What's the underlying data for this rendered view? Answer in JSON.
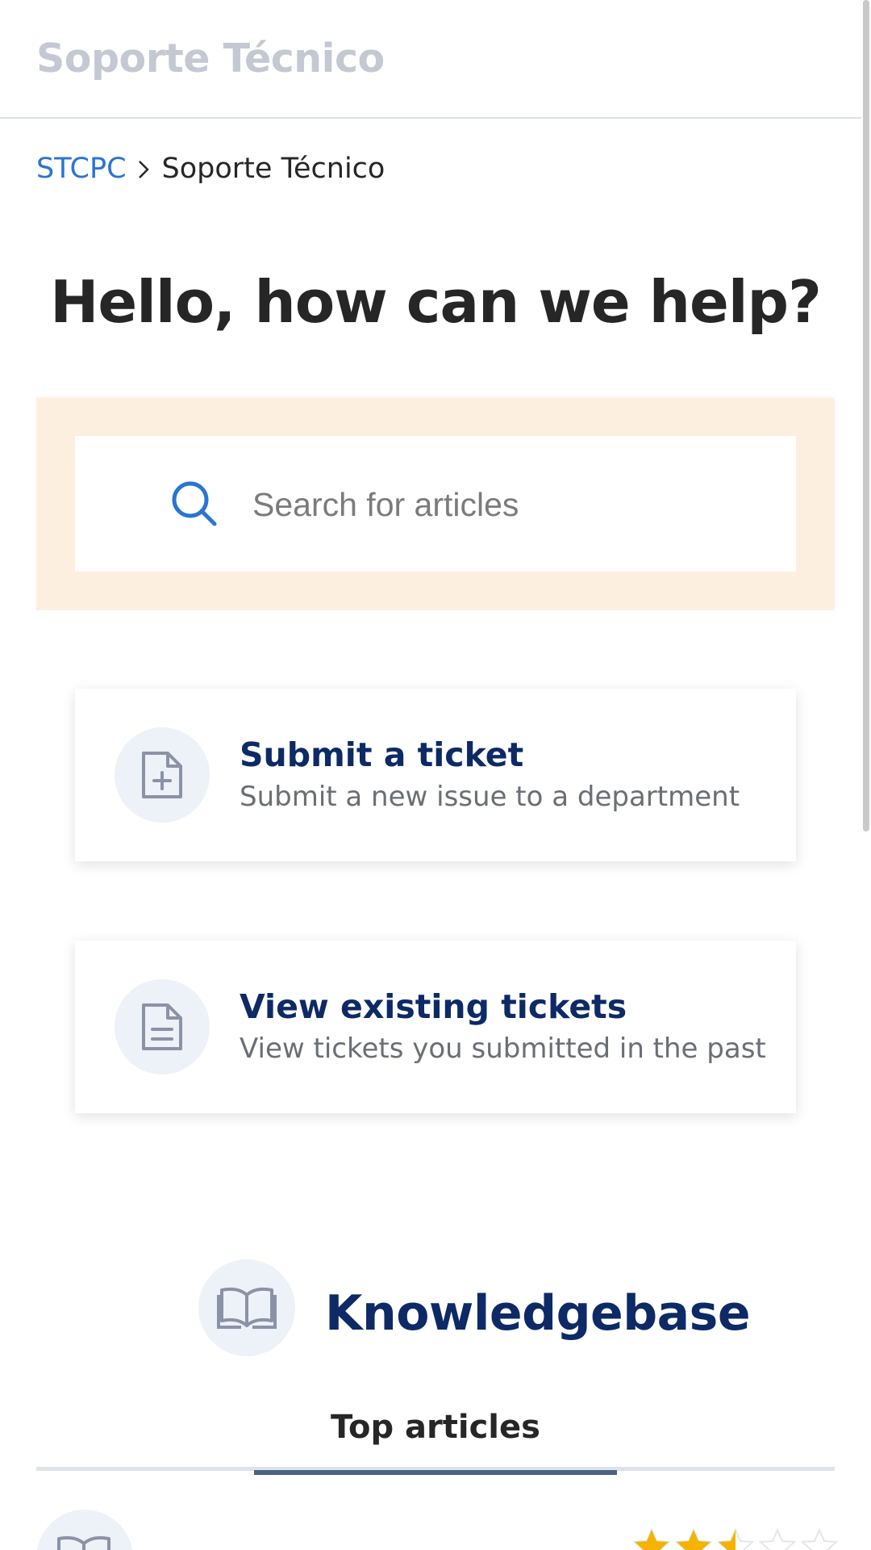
{
  "header": {
    "brand": "Soporte Técnico"
  },
  "breadcrumb": {
    "home": "STCPC",
    "current": "Soporte Técnico"
  },
  "hero": {
    "title": "Hello, how can we help?"
  },
  "search": {
    "placeholder": "Search for articles",
    "value": ""
  },
  "cards": [
    {
      "title": "Submit a ticket",
      "description": "Submit a new issue to a department",
      "icon": "file-plus-icon"
    },
    {
      "title": "View existing tickets",
      "description": "View tickets you submitted in the past",
      "icon": "file-text-icon"
    }
  ],
  "knowledgebase": {
    "title": "Knowledgebase",
    "icon": "open-book-icon",
    "tabs": [
      {
        "label": "Top articles",
        "active": true
      }
    ],
    "first_article": {
      "rating": 2.5,
      "rating_max": 5
    }
  },
  "colors": {
    "accent": "#2a74d5",
    "heading": "#0d2a66",
    "search_band": "#fdefe0",
    "star": "#f5b301"
  }
}
